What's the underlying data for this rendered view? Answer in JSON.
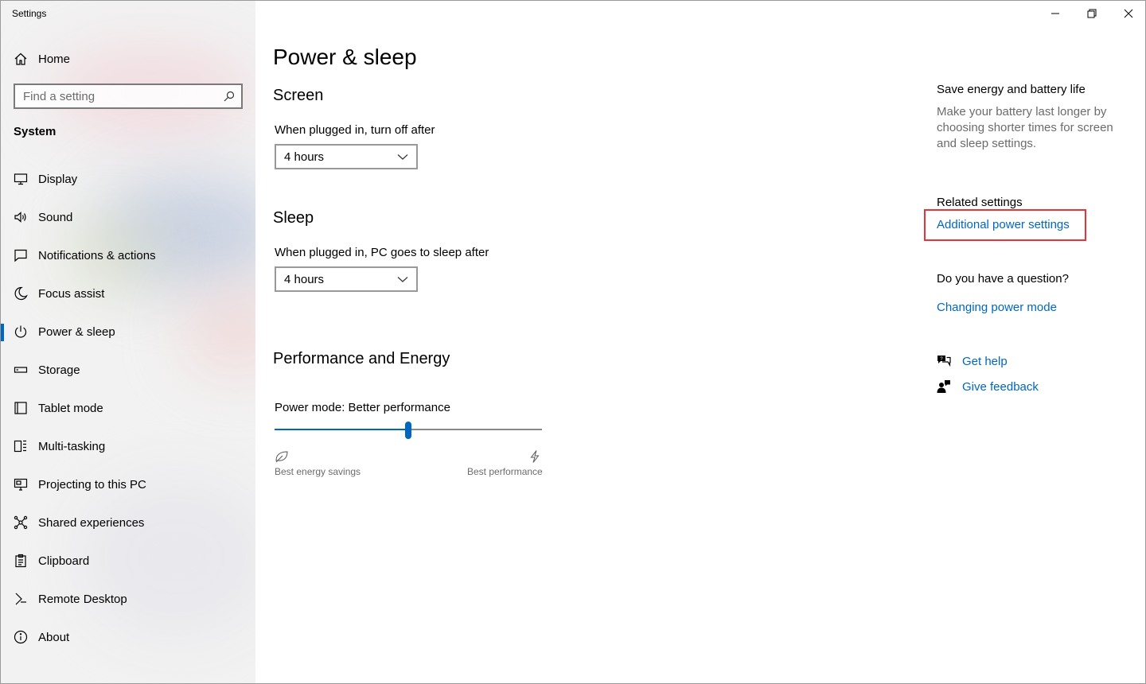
{
  "window": {
    "title": "Settings"
  },
  "sidebar": {
    "home_label": "Home",
    "search_placeholder": "Find a setting",
    "section_title": "System",
    "items": [
      {
        "label": "Display",
        "icon": "monitor-icon"
      },
      {
        "label": "Sound",
        "icon": "speaker-icon"
      },
      {
        "label": "Notifications & actions",
        "icon": "notifications-icon"
      },
      {
        "label": "Focus assist",
        "icon": "moon-icon"
      },
      {
        "label": "Power & sleep",
        "icon": "power-icon",
        "active": true
      },
      {
        "label": "Storage",
        "icon": "storage-icon"
      },
      {
        "label": "Tablet mode",
        "icon": "tablet-icon"
      },
      {
        "label": "Multi-tasking",
        "icon": "multitasking-icon"
      },
      {
        "label": "Projecting to this PC",
        "icon": "project-icon"
      },
      {
        "label": "Shared experiences",
        "icon": "shared-experiences-icon"
      },
      {
        "label": "Clipboard",
        "icon": "clipboard-icon"
      },
      {
        "label": "Remote Desktop",
        "icon": "remote-desktop-icon"
      },
      {
        "label": "About",
        "icon": "info-icon"
      }
    ]
  },
  "main": {
    "title": "Power & sleep",
    "screen": {
      "heading": "Screen",
      "label": "When plugged in, turn off after",
      "value": "4 hours"
    },
    "sleep": {
      "heading": "Sleep",
      "label": "When plugged in, PC goes to sleep after",
      "value": "4 hours"
    },
    "performance": {
      "heading": "Performance and Energy",
      "label": "Power mode: Better performance",
      "slider_level": 0.5,
      "min_caption": "Best energy savings",
      "max_caption": "Best performance"
    }
  },
  "right": {
    "save_heading": "Save energy and battery life",
    "save_text": "Make your battery last longer by choosing shorter times for screen and sleep settings.",
    "related_heading": "Related settings",
    "additional_link": "Additional power settings",
    "question_heading": "Do you have a question?",
    "changing_link": "Changing power mode",
    "get_help": "Get help",
    "give_feedback": "Give feedback"
  },
  "colors": {
    "accent": "#0067c0",
    "highlight": "#e8333a"
  }
}
